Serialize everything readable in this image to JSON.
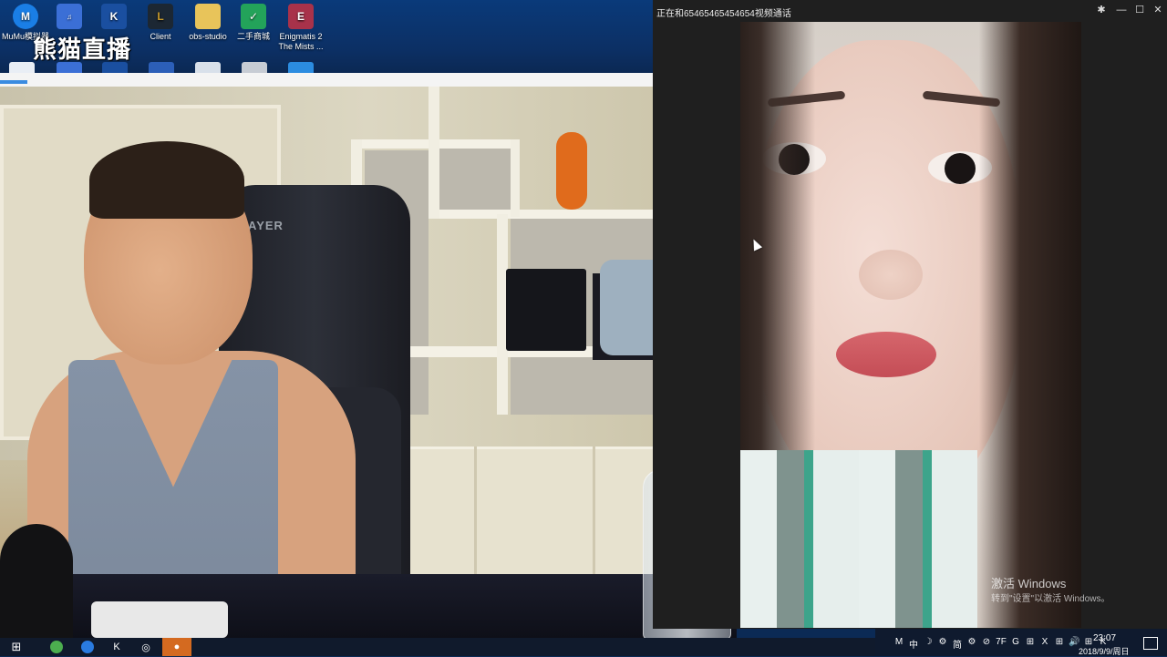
{
  "desktop": {
    "icons": [
      {
        "label": "MuMu模拟器",
        "color": "#1a7ee6",
        "glyph": "M"
      },
      {
        "label": "",
        "color": "#3b6fd6",
        "glyph": "MP3"
      },
      {
        "label": "",
        "color": "#1a4fa0",
        "glyph": "K"
      },
      {
        "label": "Client",
        "color": "#c89a2a",
        "glyph": "L"
      },
      {
        "label": "obs-studio",
        "color": "#e8c45a",
        "glyph": ""
      },
      {
        "label": "二手商城",
        "color": "#23a35a",
        "glyph": "✓"
      },
      {
        "label": "Enigmatis 2 The Mists ...",
        "color": "#a8324a",
        "glyph": "E"
      }
    ],
    "overlay_logo": "熊猫直播"
  },
  "call_window": {
    "title": "正在和65465465454654视频通话",
    "pin_icon": "pin-icon",
    "minimize_icon": "minimize-icon",
    "maximize_icon": "maximize-icon",
    "close_icon": "close-icon"
  },
  "left_cam": {
    "chair_brand": "AYER"
  },
  "watermark": {
    "line1": "激活 Windows",
    "line2": "转到\"设置\"以激活 Windows。"
  },
  "taskbar": {
    "tray_icons": [
      "M",
      "中",
      "☽",
      "⚙",
      "简",
      "⚙",
      "⊘",
      "7F",
      "G",
      "⊞",
      "X",
      "⊞",
      "🔊",
      "⊞",
      "K"
    ],
    "time": "23:07",
    "date": "2018/9/9/周日"
  }
}
